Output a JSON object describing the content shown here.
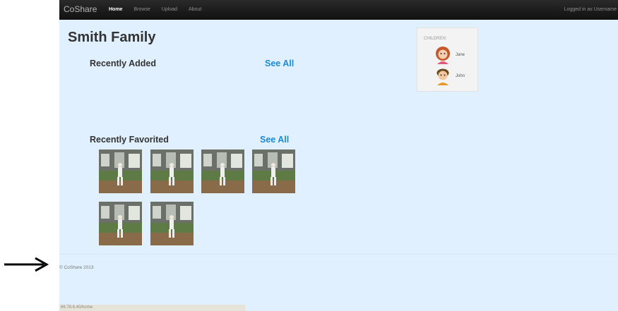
{
  "navbar": {
    "brand": "CoShare",
    "links": [
      {
        "label": "Home",
        "active": true
      },
      {
        "label": "Browse",
        "active": false
      },
      {
        "label": "Upload",
        "active": false
      },
      {
        "label": "About",
        "active": false
      }
    ],
    "login_text": "Logged in as Username"
  },
  "page_title": "Smith Family",
  "recently_added": {
    "title": "Recently Added",
    "see_all": "See All"
  },
  "recently_favorited": {
    "title": "Recently Favorited",
    "see_all": "See All",
    "photos": [
      "baseball-photo",
      "baseball-photo",
      "baseball-photo",
      "baseball-photo",
      "baseball-photo",
      "baseball-photo"
    ]
  },
  "children": {
    "label": "CHILDREN:",
    "items": [
      {
        "name": "Jane",
        "avatar": "girl-avatar"
      },
      {
        "name": "John",
        "avatar": "boy-avatar"
      }
    ]
  },
  "footer": "© CoShare 2013",
  "status_url": "66.78.6.40/home",
  "annotation": {
    "icon": "right-arrow-icon"
  },
  "colors": {
    "navbar": "#1b1b1b",
    "page_background": "#e0f0fe",
    "link": "#1a8ad4",
    "sidebar_panel": "#f3f3f3"
  }
}
